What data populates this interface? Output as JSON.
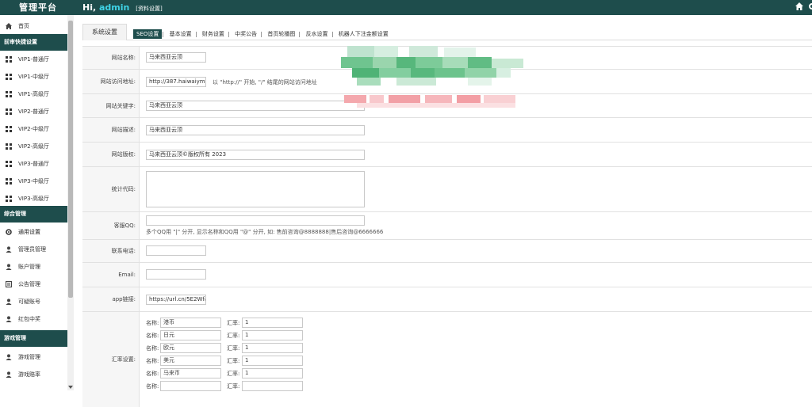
{
  "header": {
    "brand": "管理平台",
    "greeting_prefix": "Hi, ",
    "username": "admin",
    "profile_link": "[资料设置]"
  },
  "sidebar": {
    "items_top": [
      {
        "label": "首页",
        "icon": "home-icon"
      }
    ],
    "section1": "前审快捷设置",
    "section1_items": [
      {
        "label": "VIP1-普通厅"
      },
      {
        "label": "VIP1-中级厅"
      },
      {
        "label": "VIP1-高级厅"
      },
      {
        "label": "VIP2-普通厅"
      },
      {
        "label": "VIP2-中级厅"
      },
      {
        "label": "VIP2-高级厅"
      },
      {
        "label": "VIP3-普通厅"
      },
      {
        "label": "VIP3-中级厅"
      },
      {
        "label": "VIP3-高级厅"
      }
    ],
    "section2": "综合管理",
    "section2_items": [
      {
        "label": "通用设置",
        "icon": "gear-icon"
      },
      {
        "label": "管理员管理",
        "icon": "user-icon"
      },
      {
        "label": "账户管理",
        "icon": "user-icon"
      },
      {
        "label": "公告管理",
        "icon": "notice-icon"
      },
      {
        "label": "可疑账号",
        "icon": "user-icon"
      },
      {
        "label": "红包中奖",
        "icon": "user-icon"
      }
    ],
    "section3": "游戏管理",
    "section3_items": [
      {
        "label": "游戏管理",
        "icon": "user-icon"
      },
      {
        "label": "游戏赔率",
        "icon": "user-icon"
      }
    ]
  },
  "tabs": {
    "system": "系统设置",
    "sub": [
      "SEO设置",
      "基本设置",
      "财务设置",
      "中奖公告",
      "首页轮播图",
      "反水设置",
      "机器人下注金额设置"
    ]
  },
  "form": {
    "site_name": {
      "label": "网站名称:",
      "value": "马来西亚云顶"
    },
    "site_url": {
      "label": "网站访问地址:",
      "value": "http://387.haiwaiym12.",
      "hint": "以 \"http://\" 开始,  \"/\" 结尾的网站访问地址"
    },
    "keywords": {
      "label": "网站关键字:",
      "value": "马来西亚云顶"
    },
    "description": {
      "label": "网站描述:",
      "value": "马来西亚云顶"
    },
    "copyright": {
      "label": "网站版权:",
      "value": "马来西亚云顶©版权所有 2023"
    },
    "stats_code": {
      "label": "统计代码:"
    },
    "qq": {
      "label": "客服QQ:",
      "hint": "多个QQ用 \"|\" 分开, 显示名称和QQ用 \"@\" 分开, 如: 售前咨询@8888888|售后咨询@6666666"
    },
    "phone": {
      "label": "联系电话:"
    },
    "email": {
      "label": "Email:"
    },
    "app_link": {
      "label": "app链接:",
      "value": "https://url.cn/5E2WfaQ"
    },
    "exchange": {
      "label": "汇率设置:",
      "name_label": "名称:",
      "rate_label": "汇率:",
      "rows": [
        {
          "name": "港币",
          "rate": "1"
        },
        {
          "name": "日元",
          "rate": "1"
        },
        {
          "name": "欧元",
          "rate": "1"
        },
        {
          "name": "美元",
          "rate": "1"
        },
        {
          "name": "马来币",
          "rate": "1"
        },
        {
          "name": "",
          "rate": ""
        }
      ]
    }
  }
}
